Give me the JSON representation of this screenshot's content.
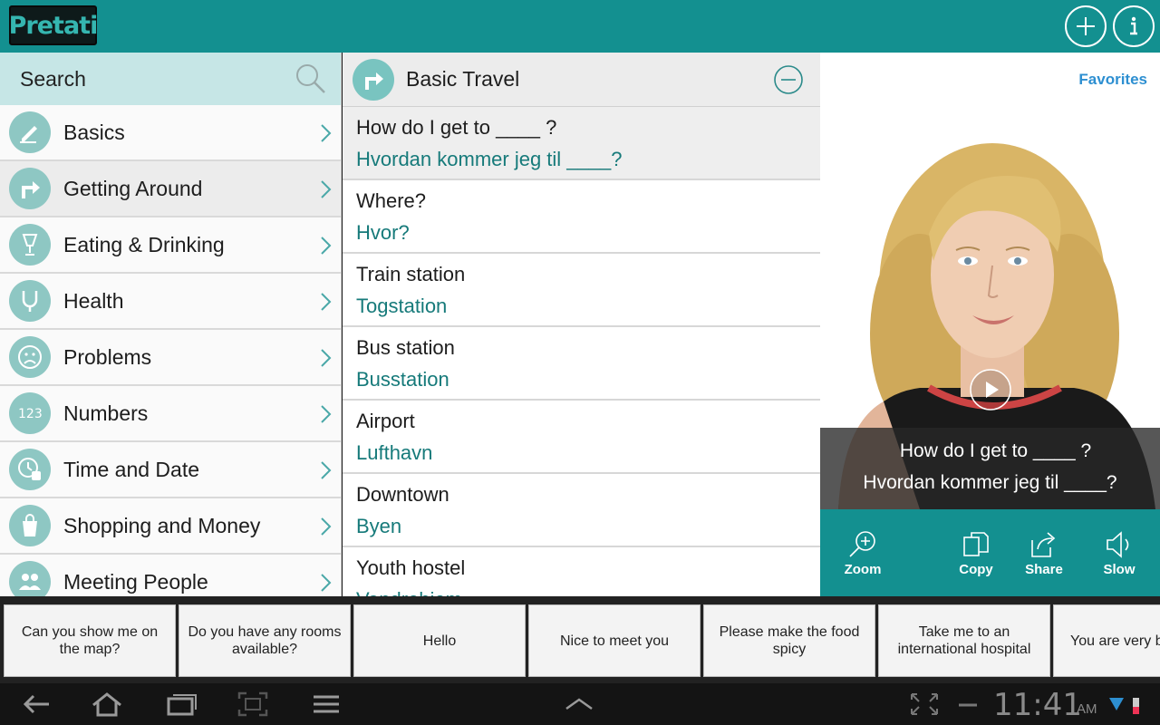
{
  "app": {
    "logo": "Pretati",
    "add_icon": "plus-circle-icon",
    "info_icon": "info-circle-icon"
  },
  "search": {
    "label": "Search",
    "icon": "magnifier-icon"
  },
  "categories": [
    {
      "label": "Basics",
      "icon": "pencil-note-icon"
    },
    {
      "label": "Getting Around",
      "icon": "turn-arrow-icon"
    },
    {
      "label": "Eating & Drinking",
      "icon": "glass-icon"
    },
    {
      "label": "Health",
      "icon": "stethoscope-icon"
    },
    {
      "label": "Problems",
      "icon": "sad-face-icon"
    },
    {
      "label": "Numbers",
      "icon": "numbers-icon"
    },
    {
      "label": "Time and Date",
      "icon": "clock-calendar-icon"
    },
    {
      "label": "Shopping and Money",
      "icon": "shopping-bag-icon"
    },
    {
      "label": "Meeting People",
      "icon": "people-icon"
    }
  ],
  "phrase_list": {
    "title": "Basic Travel",
    "phrases": [
      {
        "en": "How do I get to ____ ?",
        "no": "Hvordan kommer jeg til ____?"
      },
      {
        "en": "Where?",
        "no": "Hvor?"
      },
      {
        "en": "Train station",
        "no": "Togstation"
      },
      {
        "en": "Bus station",
        "no": "Busstation"
      },
      {
        "en": "Airport",
        "no": "Lufthavn"
      },
      {
        "en": "Downtown",
        "no": "Byen"
      },
      {
        "en": "Youth hostel",
        "no": "Vandrehjem"
      }
    ]
  },
  "video_panel": {
    "favorites": "Favorites",
    "caption_en": "How do I get to ____ ?",
    "caption_no": "Hvordan kommer jeg til ____?",
    "actions": {
      "zoom": "Zoom",
      "copy": "Copy",
      "share": "Share",
      "slow": "Slow"
    }
  },
  "quick_phrases": [
    "Can you show me on the map?",
    "Do you have any rooms available?",
    "Hello",
    "Nice to meet you",
    "Please make the food spicy",
    "Take me to an international hospital",
    "You are very beautiful"
  ],
  "system_bar": {
    "time": "11:41",
    "ampm": "AM"
  },
  "colors": {
    "brand_teal": "#139090",
    "translation_text": "#167a7a",
    "search_bg": "#c6e6e6",
    "favorites_link": "#2d8fd1"
  }
}
